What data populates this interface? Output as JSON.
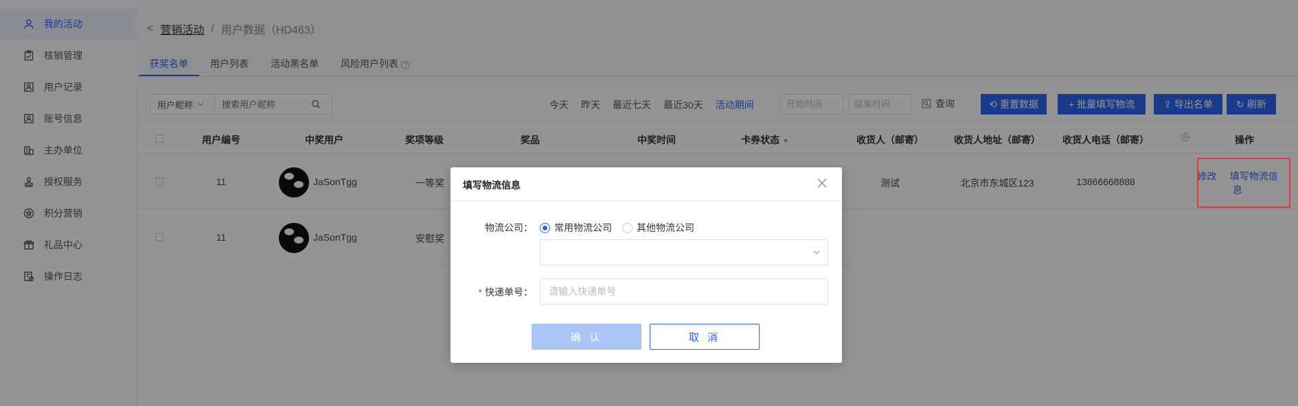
{
  "sidebar": {
    "items": [
      {
        "label": "我的活动",
        "icon": "user-icon",
        "active": true
      },
      {
        "label": "核销管理",
        "icon": "clipboard-check-icon"
      },
      {
        "label": "用户记录",
        "icon": "id-card-icon"
      },
      {
        "label": "账号信息",
        "icon": "account-card-icon"
      },
      {
        "label": "主办单位",
        "icon": "building-icon"
      },
      {
        "label": "授权服务",
        "icon": "stamp-icon"
      },
      {
        "label": "积分营销",
        "icon": "star-coin-icon"
      },
      {
        "label": "礼品中心",
        "icon": "gift-icon"
      },
      {
        "label": "操作日志",
        "icon": "log-icon"
      }
    ]
  },
  "breadcrumb": {
    "back": "<",
    "parent": "营销活动",
    "separator": "/",
    "current": "用户数据（HD463）"
  },
  "tabs": [
    "获奖名单",
    "用户列表",
    "活动黑名单",
    "风险用户列表"
  ],
  "filter": {
    "field_select": "用户昵称",
    "search_placeholder": "搜索用户昵称",
    "dates": [
      "今天",
      "昨天",
      "最近七天",
      "最近30天",
      "活动期间"
    ],
    "start_placeholder": "开始时间",
    "end_placeholder": "结束时间",
    "query": "查询",
    "reset": "重置数据",
    "batch": "批量填写物流",
    "export": "导出名单",
    "refresh": "刷新"
  },
  "table": {
    "headers": [
      "用户编号",
      "中奖用户",
      "奖项等级",
      "奖品",
      "中奖时间",
      "卡券状态",
      "收货人（邮寄）",
      "收货人地址（邮寄）",
      "收货人电话（邮寄）",
      "操作"
    ],
    "rows": [
      {
        "id": "11",
        "user": "JaSonTgg",
        "level": "一等奖",
        "receiver": "测试",
        "address": "北京市东城区123",
        "phone": "13866668888",
        "ops": [
          "修改",
          "填写物流信息"
        ]
      },
      {
        "id": "11",
        "user": "JaSonTgg",
        "level": "安慰奖",
        "receiver": "",
        "address": "",
        "phone": "",
        "ops": []
      }
    ]
  },
  "modal": {
    "title": "填写物流信息",
    "company_label": "物流公司：",
    "radio_common": "常用物流公司",
    "radio_other": "其他物流公司",
    "tracking_label": "快递单号：",
    "tracking_placeholder": "请输入快递单号",
    "confirm": "确 认",
    "cancel": "取 消"
  },
  "colors": {
    "accent": "#2d64ee",
    "highlight": "#e53935"
  }
}
